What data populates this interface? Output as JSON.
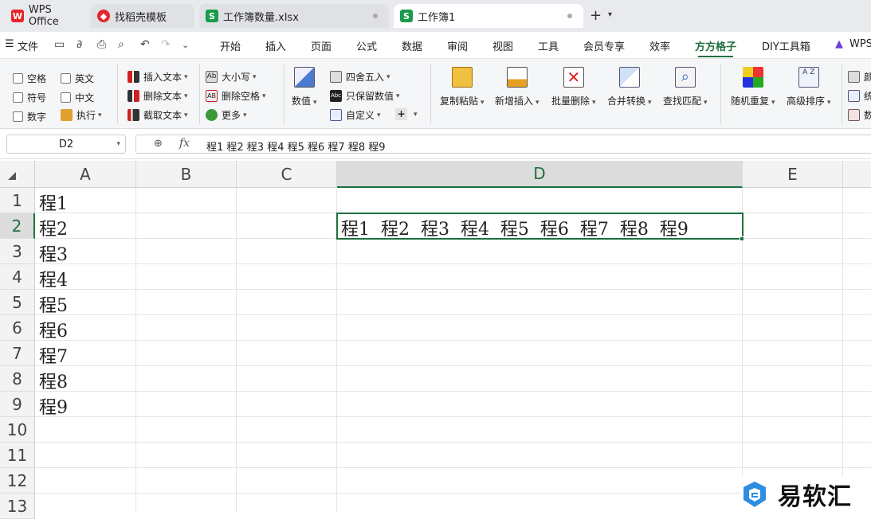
{
  "tabs": [
    {
      "label": "WPS Office",
      "icon": "wps-logo-icon"
    },
    {
      "label": "找稻壳模板",
      "icon": "docer-icon"
    },
    {
      "label": "工作簿数量.xlsx",
      "icon": "sheet-icon"
    },
    {
      "label": "工作簿1",
      "icon": "sheet-icon"
    }
  ],
  "new_tab": "+",
  "menu": {
    "file": "文件",
    "items": [
      "开始",
      "插入",
      "页面",
      "公式",
      "数据",
      "审阅",
      "视图",
      "工具",
      "会员专享",
      "效率",
      "方方格子",
      "DIY工具箱",
      "WPS"
    ],
    "active": "方方格子"
  },
  "ribbon": {
    "checkboxes": [
      "空格",
      "英文",
      "符号",
      "中文",
      "数字"
    ],
    "exec": "执行",
    "text_ops": [
      "插入文本",
      "删除文本",
      "截取文本"
    ],
    "case_ops": [
      "大小写",
      "删除空格",
      "更多"
    ],
    "number": "数值",
    "round_ops": [
      "四舍五入",
      "只保留数值",
      "自定义"
    ],
    "big_buttons": [
      "复制粘贴",
      "新增插入",
      "批量删除",
      "合并转换",
      "查找匹配",
      "随机重复",
      "高级排序"
    ],
    "right_cut": [
      "颜",
      "统",
      "数"
    ]
  },
  "formula_bar": {
    "cell_ref": "D2",
    "fx": "fx",
    "value": "程1  程2  程3  程4  程5  程6  程7  程8  程9"
  },
  "sheet": {
    "columns": [
      "A",
      "B",
      "C",
      "D",
      "E"
    ],
    "selected_column": "D",
    "rows": [
      "1",
      "2",
      "3",
      "4",
      "5",
      "6",
      "7",
      "8",
      "9",
      "10",
      "11",
      "12",
      "13"
    ],
    "selected_row": "2",
    "col_a": [
      "程1",
      "程2",
      "程3",
      "程4",
      "程5",
      "程6",
      "程7",
      "程8",
      "程9"
    ],
    "d2": "程1  程2  程3  程4  程5  程6  程7  程8  程9"
  },
  "watermark": "易软汇",
  "colors": {
    "accent": "#1f6f3e",
    "wps_red": "#e5252a",
    "sheet_green": "#1a9b4b"
  }
}
